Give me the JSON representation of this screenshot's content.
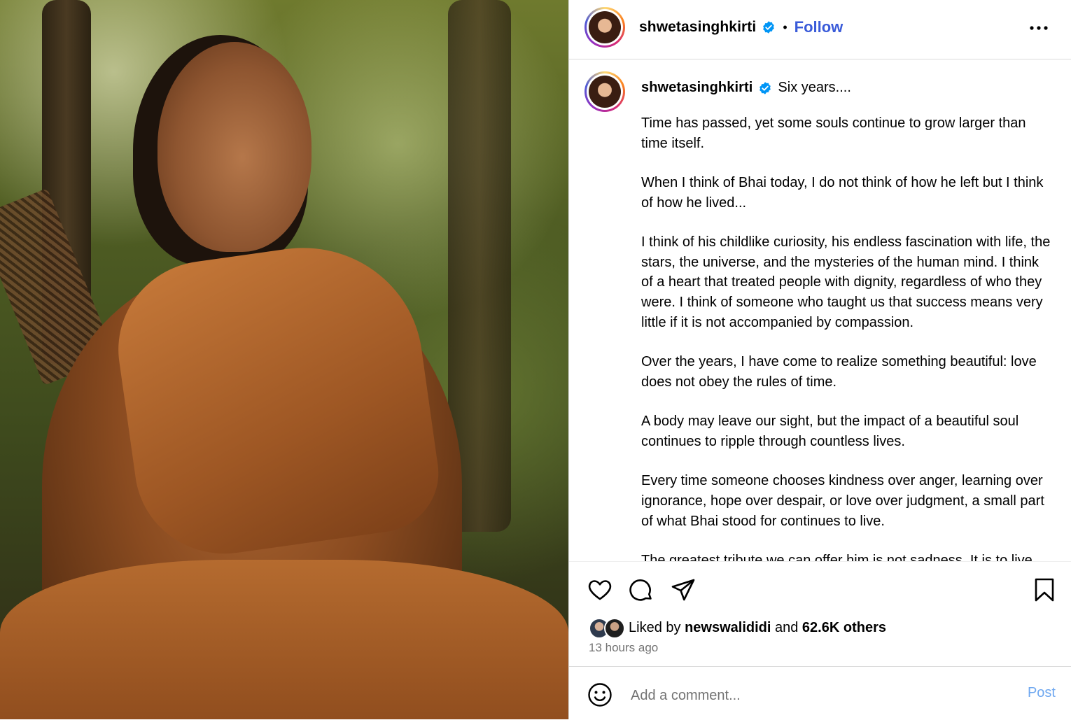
{
  "media": {
    "icon": "post-image"
  },
  "header": {
    "username": "shwetasinghkirti",
    "separator": "•",
    "follow_label": "Follow",
    "verified_icon": "verified-badge-icon",
    "more_icon": "more-options-icon"
  },
  "caption": {
    "username": "shwetasinghkirti",
    "lead": "Six years....",
    "paragraphs": [
      "Time has passed, yet some souls continue to grow larger than time itself.",
      "When I think of Bhai today, I do not think of how he left but I think of how he lived...",
      "I think of his childlike curiosity, his endless fascination with life, the stars, the universe, and the mysteries of the human mind. I think of a heart that treated people with dignity, regardless of who they were. I think of someone who taught us that success means very little if it is not accompanied by compassion.",
      "Over the years, I have come to realize something beautiful: love does not obey the rules of time.",
      "A body may leave our sight, but the impact of a beautiful soul continues to ripple through countless lives.",
      "Every time someone chooses kindness over anger, learning over ignorance, hope over despair, or love over judgment, a small part of what Bhai stood for continues to live.",
      "The greatest tribute we can offer him is not sadness. It is to live"
    ]
  },
  "actions": {
    "like_icon": "heart-icon",
    "comment_icon": "comment-icon",
    "share_icon": "send-icon",
    "save_icon": "bookmark-icon"
  },
  "likes": {
    "prefix": "Liked by",
    "user": "newswalididi",
    "middle": "and",
    "others": "62.6K others"
  },
  "time": "13 hours ago",
  "comment": {
    "emoji_icon": "emoji-icon",
    "placeholder": "Add a comment...",
    "post_label": "Post"
  },
  "colors": {
    "follow": "#3a5bd9",
    "verified": "#0095f6",
    "post_button": "#6fa8f0",
    "muted": "#737373"
  }
}
